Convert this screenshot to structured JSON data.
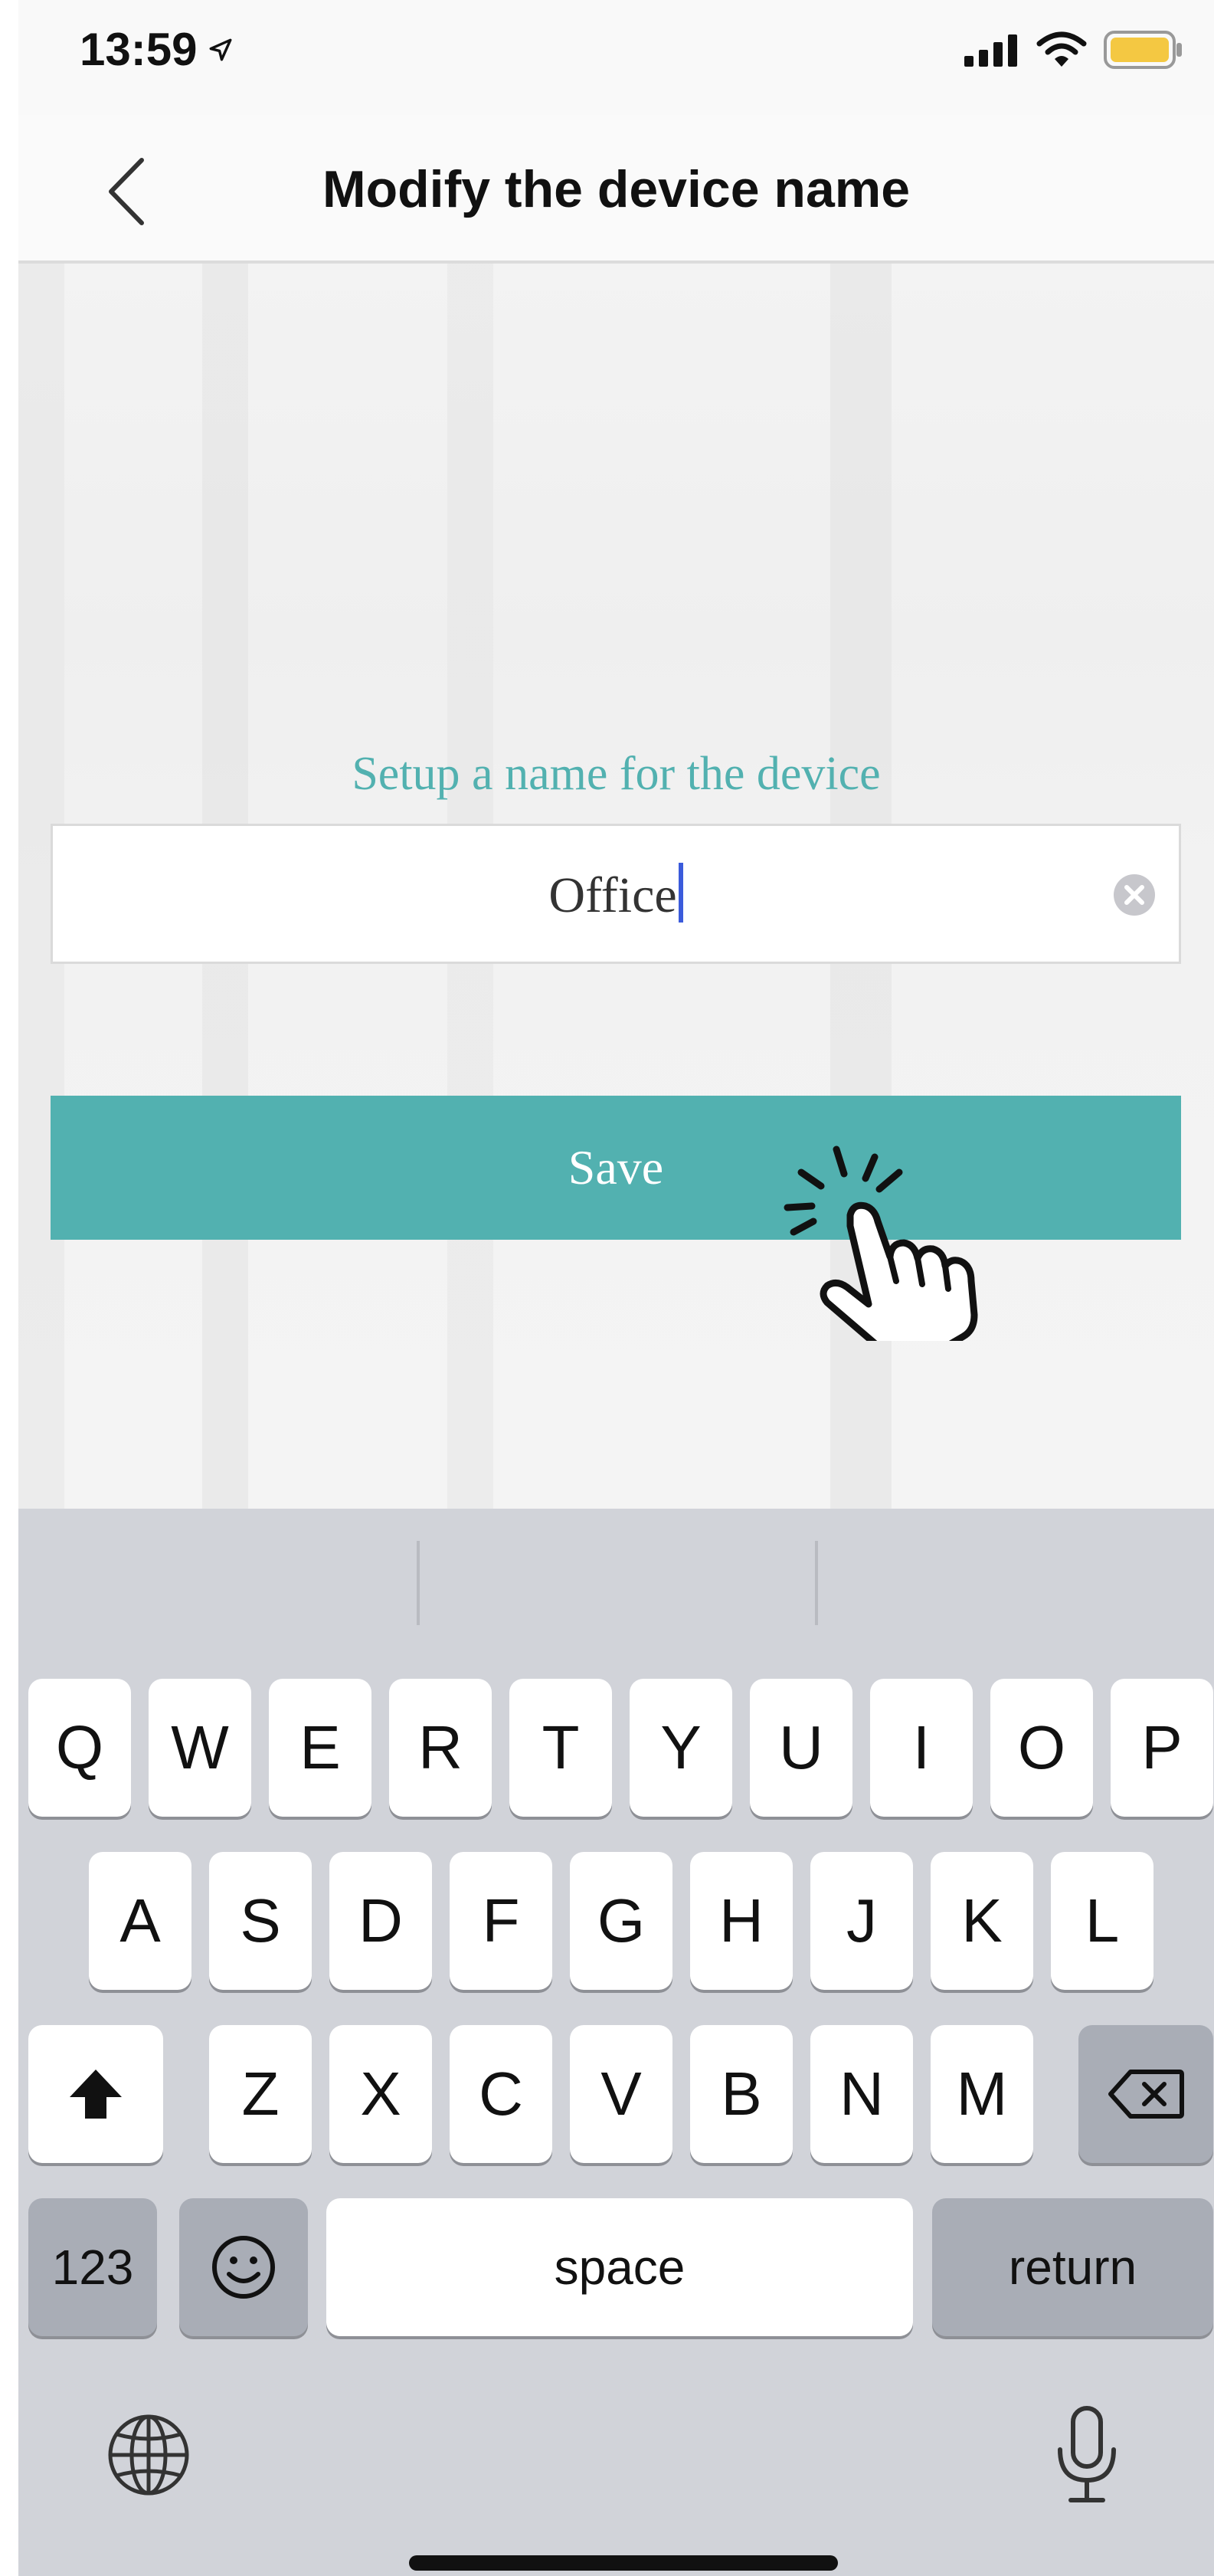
{
  "status_bar": {
    "time": "13:59"
  },
  "nav": {
    "title": "Modify the device name"
  },
  "form": {
    "caption": "Setup a name for the device",
    "name_value": "Office",
    "save_label": "Save"
  },
  "keyboard": {
    "row1": [
      "Q",
      "W",
      "E",
      "R",
      "T",
      "Y",
      "U",
      "I",
      "O",
      "P"
    ],
    "row2": [
      "A",
      "S",
      "D",
      "F",
      "G",
      "H",
      "J",
      "K",
      "L"
    ],
    "row3": [
      "Z",
      "X",
      "C",
      "V",
      "B",
      "N",
      "M"
    ],
    "numbers_label": "123",
    "space_label": "space",
    "return_label": "return"
  },
  "colors": {
    "accent": "#52b1b0",
    "keyboard_bg": "#d1d3d9",
    "caret": "#3b5bdb"
  }
}
